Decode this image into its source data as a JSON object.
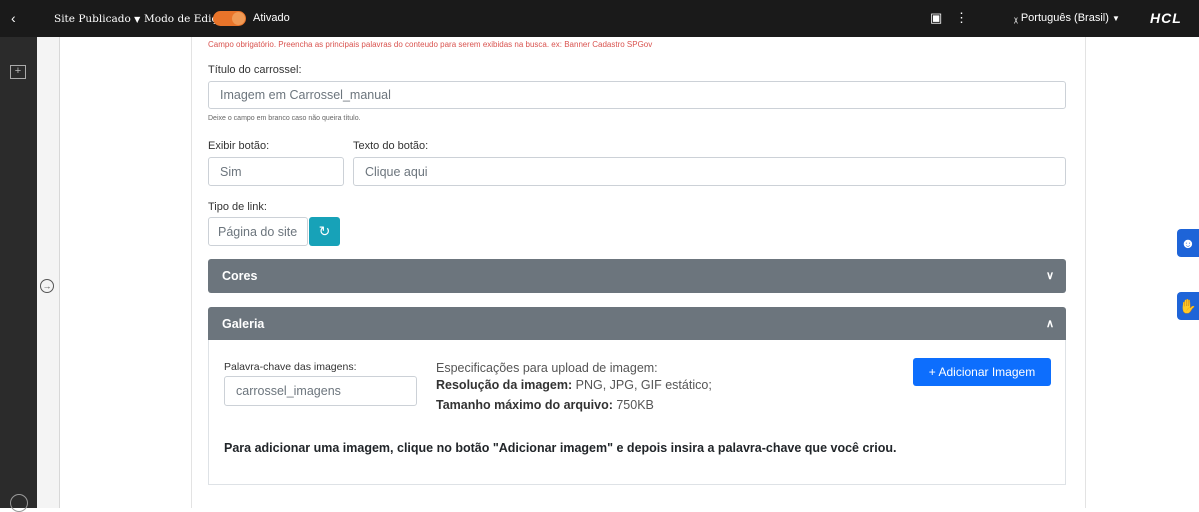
{
  "topbar": {
    "back_icon": "chevron-left-icon",
    "site_status": "Site Publicado",
    "edit_mode_label": "Modo de Edição:",
    "edit_mode_value": "Ativado",
    "language": "Português (Brasil)",
    "brand": "HCL"
  },
  "form": {
    "required_hint": "Campo obrigatório. Preencha as principais palavras do conteudo para serem exibidas na busca. ex: Banner Cadastro SPGov",
    "title_label": "Título do carrossel:",
    "title_value": "Imagem em Carrossel_manual",
    "title_hint": "Deixe o campo em branco caso não queira título.",
    "show_button_label": "Exibir botão:",
    "show_button_value": "Sim",
    "button_text_label": "Texto do botão:",
    "button_text_value": "Clique aqui",
    "link_type_label": "Tipo de link:",
    "link_type_value": "Página do site"
  },
  "accordions": {
    "colors_title": "Cores",
    "gallery_title": "Galeria"
  },
  "gallery": {
    "keyword_label": "Palavra-chave das imagens:",
    "keyword_value": "carrossel_imagens",
    "specs_title": "Especificações para upload de imagem:",
    "resolution_label": "Resolução da imagem:",
    "resolution_value": "PNG, JPG, GIF estático;",
    "maxsize_label": "Tamanho máximo do arquivo:",
    "maxsize_value": "750KB",
    "add_button": "+ Adicionar Imagem",
    "instruction": "Para adicionar uma imagem, clique no botão \"Adicionar imagem\" e depois insira a palavra-chave que você criou."
  }
}
